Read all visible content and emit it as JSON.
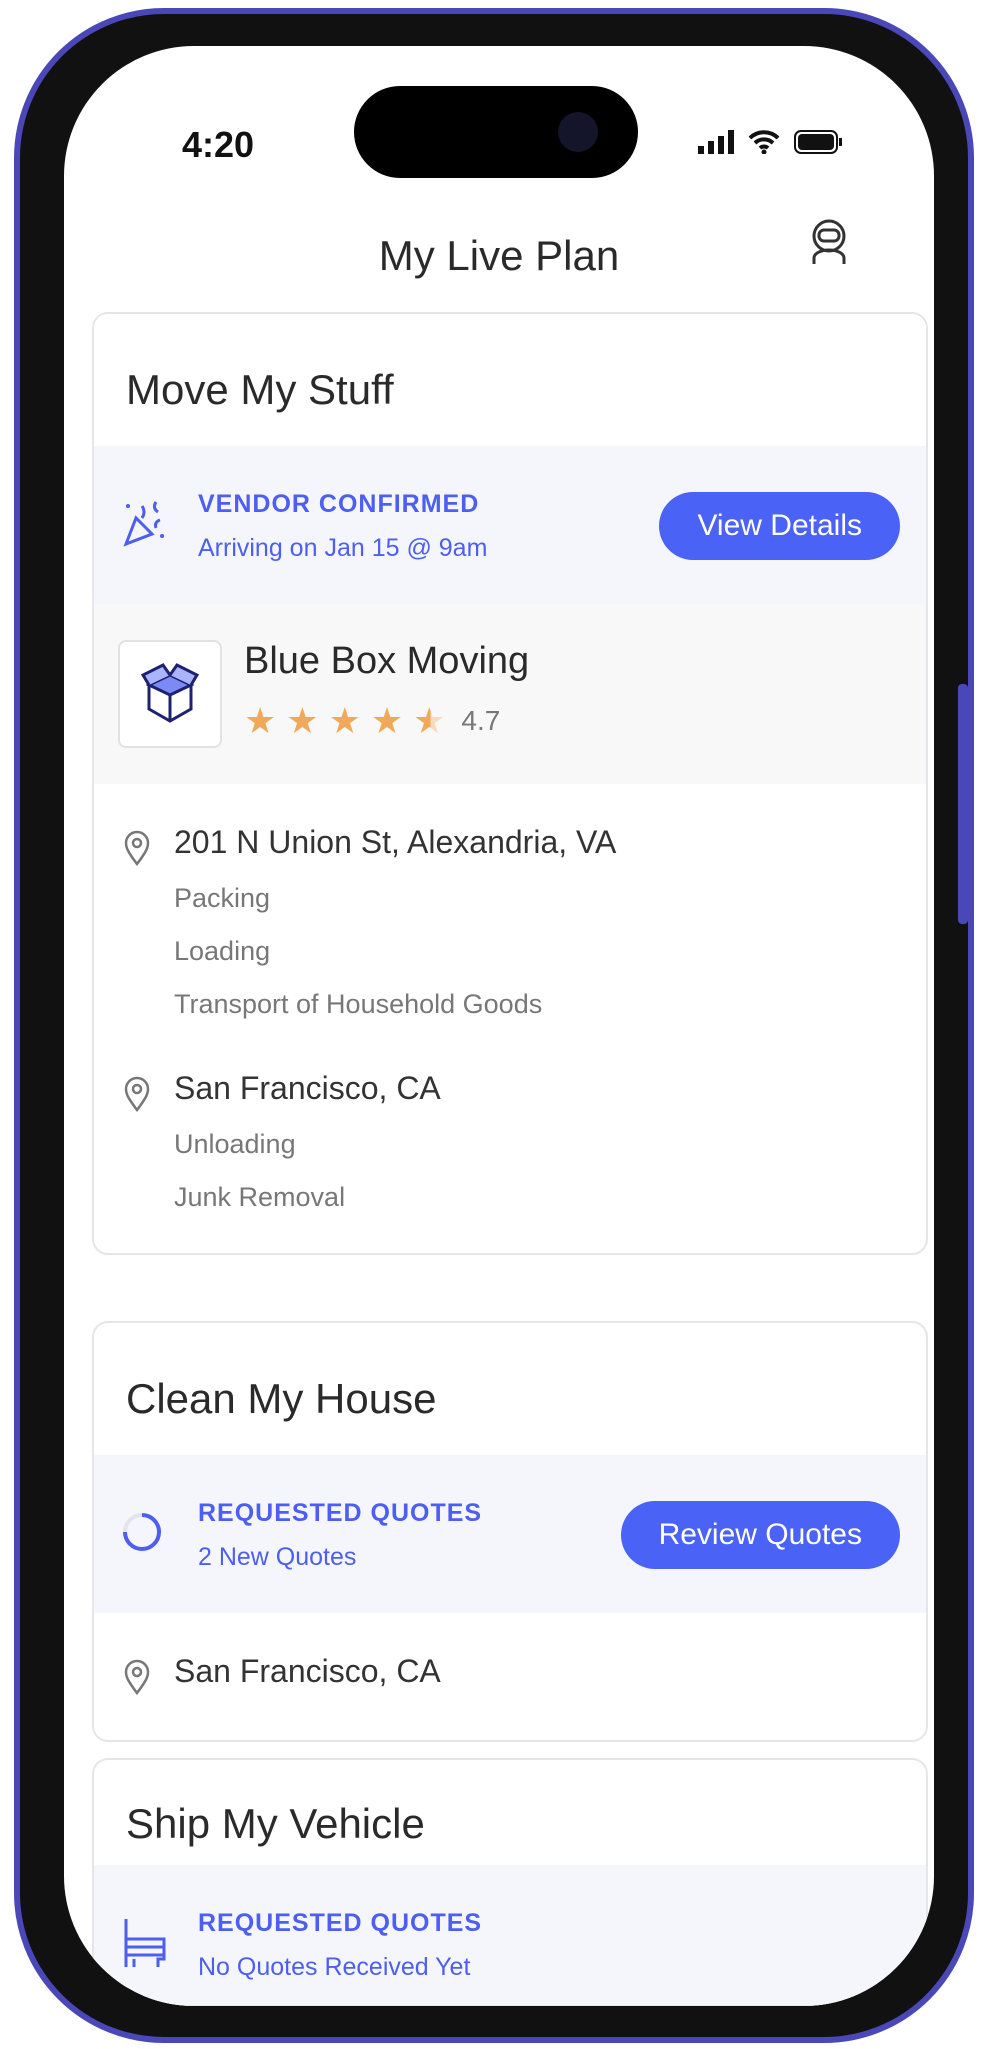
{
  "status_bar": {
    "time": "4:20"
  },
  "header": {
    "title": "My Live Plan",
    "avatar_icon": "astronaut-icon"
  },
  "accent": "#4a62f5",
  "cards": [
    {
      "title": "Move My Stuff",
      "status": {
        "icon": "party-popper-icon",
        "label": "VENDOR CONFIRMED",
        "sub": "Arriving on Jan 15 @ 9am",
        "button": "View Details"
      },
      "vendor": {
        "name": "Blue Box Moving",
        "rating": "4.7",
        "stars": 4.7
      },
      "locations": [
        {
          "address": "201 N Union St, Alexandria, VA",
          "services": [
            "Packing",
            "Loading",
            "Transport of Household Goods"
          ]
        },
        {
          "address": "San Francisco, CA",
          "services": [
            "Unloading",
            "Junk Removal"
          ]
        }
      ]
    },
    {
      "title": "Clean My House",
      "status": {
        "icon": "progress-spinner-icon",
        "label": "REQUESTED QUOTES",
        "sub": "2 New Quotes",
        "button": "Review Quotes"
      },
      "locations": [
        {
          "address": "San Francisco, CA"
        }
      ]
    },
    {
      "title": "Ship My Vehicle",
      "status": {
        "icon": "pinata-icon",
        "label": "REQUESTED QUOTES",
        "sub": "No Quotes Received Yet"
      }
    }
  ]
}
